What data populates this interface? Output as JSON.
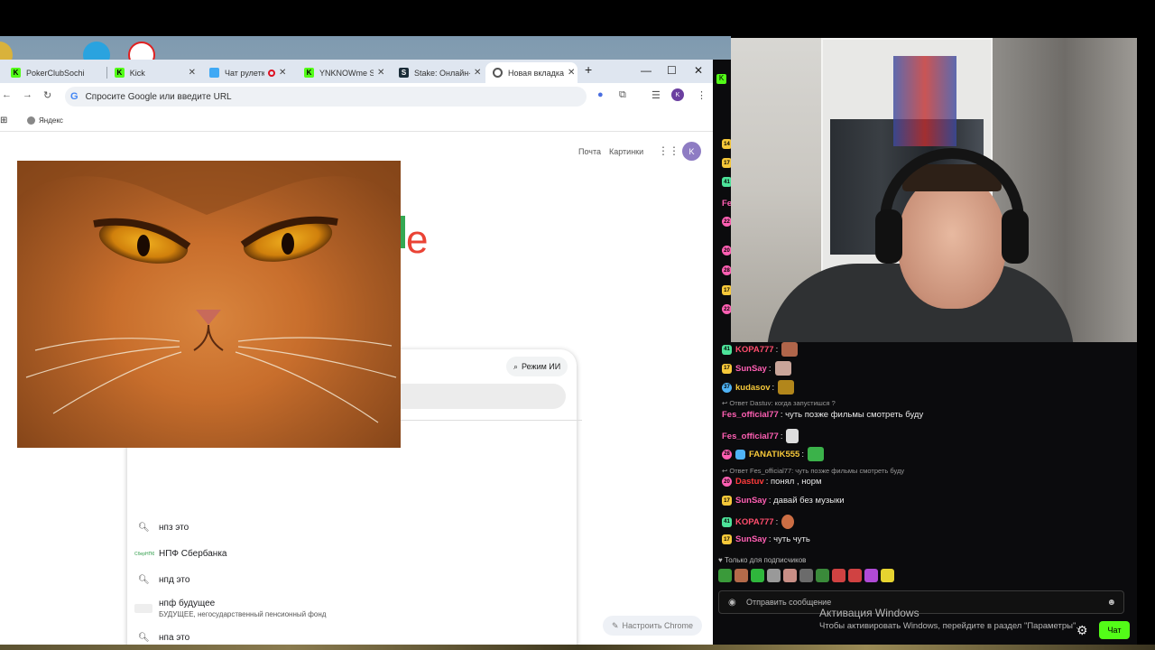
{
  "browser": {
    "tabs": [
      {
        "label": "PokerClubSochi",
        "icon": "kick-logo-icon",
        "color": "#53fc18"
      },
      {
        "label": "Kick",
        "icon": "kick-logo-icon",
        "color": "#53fc18"
      },
      {
        "label": "Чат рулетка",
        "icon": "chat-roulette-icon",
        "color": "#3fa9f5"
      },
      {
        "label": "YNKNOWme Sti",
        "icon": "kick-logo-icon",
        "color": "#53fc18"
      },
      {
        "label": "Stake: Онлайн-",
        "icon": "stake-logo-icon",
        "color": "#1a2c38"
      },
      {
        "label": "Новая вкладка",
        "icon": "chrome-icon",
        "color": "#555555"
      }
    ],
    "omnibox_placeholder": "Спросите Google или введите URL",
    "bookmark": "Яндекс",
    "profile_initial": "K"
  },
  "ntp": {
    "links": [
      "Почта",
      "Картинки"
    ],
    "profile_initial": "K",
    "ai_mode": "Режим ИИ",
    "suggestions": [
      {
        "icon": "search-icon",
        "text": "нпз это"
      },
      {
        "icon": "sber-thumb",
        "text": "НПФ Сбербанка",
        "thumb": "СберНПФ"
      },
      {
        "icon": "search-icon",
        "text": "нпд это"
      },
      {
        "icon": "budushee-thumb",
        "text": "нпф будущее",
        "sub": "БУДУЩЕЕ, негосударственный пенсионный фонд"
      },
      {
        "icon": "search-icon",
        "text": "нпа это"
      }
    ],
    "customize": "Настроить Chrome"
  },
  "chat": {
    "badge_colors": {
      "14": "#f6c83a",
      "17": "#f6c83a",
      "41": "#4de39a",
      "37": "#4fb3f6",
      "22": "#ff5fb3",
      "20": "#ff5fb3",
      "28": "#ff5fb3"
    },
    "side_badges": [
      "14",
      "17",
      "41",
      "Fe",
      "22",
      "20",
      "28",
      "17",
      "22"
    ],
    "messages": [
      {
        "badge": "41",
        "user": "KOPA777",
        "color": "#ff4d6d",
        "text": "",
        "emote": "#b0654a"
      },
      {
        "badge": "17",
        "user": "SunSay",
        "color": "#ff5fb3",
        "text": "",
        "emote": "#c9a59a"
      },
      {
        "badge": "37",
        "user": "kudasov",
        "color": "#f6c83a",
        "text": "",
        "emote": "#b2861b"
      },
      {
        "reply": "Ответ Dastuv: когда запустишся ?"
      },
      {
        "user": "Fes_official77",
        "color": "#ff5fb3",
        "text": "чуть позже фильмы смотреть буду"
      },
      {
        "user": "Fes_official77",
        "color": "#ff5fb3",
        "text": "",
        "emote": "#dddddd"
      },
      {
        "badge": "28",
        "user": "FANATIK555",
        "color": "#f6c83a",
        "text": "",
        "emote": "#3bb24a"
      },
      {
        "reply": "Ответ Fes_official77: чуть позже фильмы смотреть буду"
      },
      {
        "badge": "20",
        "user": "Dastuv",
        "color": "#ff3b3b",
        "text": "понял , норм"
      },
      {
        "badge": "17",
        "user": "SunSay",
        "color": "#ff5fb3",
        "text": "давай без музыки"
      },
      {
        "badge": "41",
        "user": "KOPA777",
        "color": "#ff4d6d",
        "text": "",
        "emote": "#cc6e44"
      },
      {
        "badge": "17",
        "user": "SunSay",
        "color": "#ff5fb3",
        "text": "чуть чуть"
      }
    ],
    "subs_only": "Только для подписчиков",
    "emote_colors": [
      "#3a9a3a",
      "#b46a4a",
      "#2fb63c",
      "#999999",
      "#c88e86",
      "#6b6b6b",
      "#3a8a3a",
      "#d04242",
      "#d04242",
      "#b04ad6",
      "#e6d330"
    ],
    "input_placeholder": "Отправить сообщение",
    "send_label": "Чат"
  },
  "windows": {
    "activation_title": "Активация Windows",
    "activation_text": "Чтобы активировать Windows, перейдите в раздел \"Параметры\"."
  }
}
